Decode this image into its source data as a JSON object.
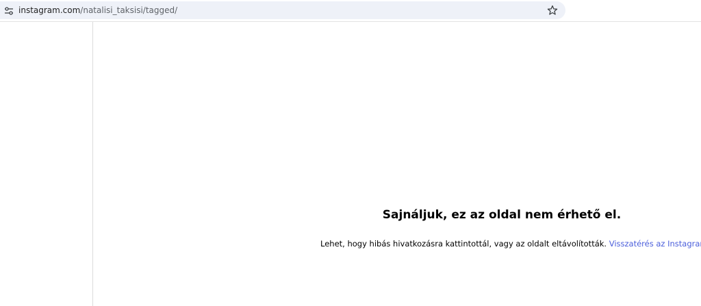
{
  "browser": {
    "url_host": "instagram.com",
    "url_path": "/natalisi_taksisi/tagged/",
    "icons": {
      "site_info": "tune-icon",
      "bookmark": "star-icon"
    }
  },
  "error": {
    "title": "Sajnáljuk, ez az oldal nem érhető el.",
    "description": "Lehet, hogy hibás hivatkozásra kattintottál, vagy az oldalt eltávolították.",
    "link_text": "Visszatérés az Instagramra."
  },
  "colors": {
    "link": "#4a5edb",
    "omnibox_bg": "#eef1f8",
    "divider": "#dbdbdb"
  }
}
